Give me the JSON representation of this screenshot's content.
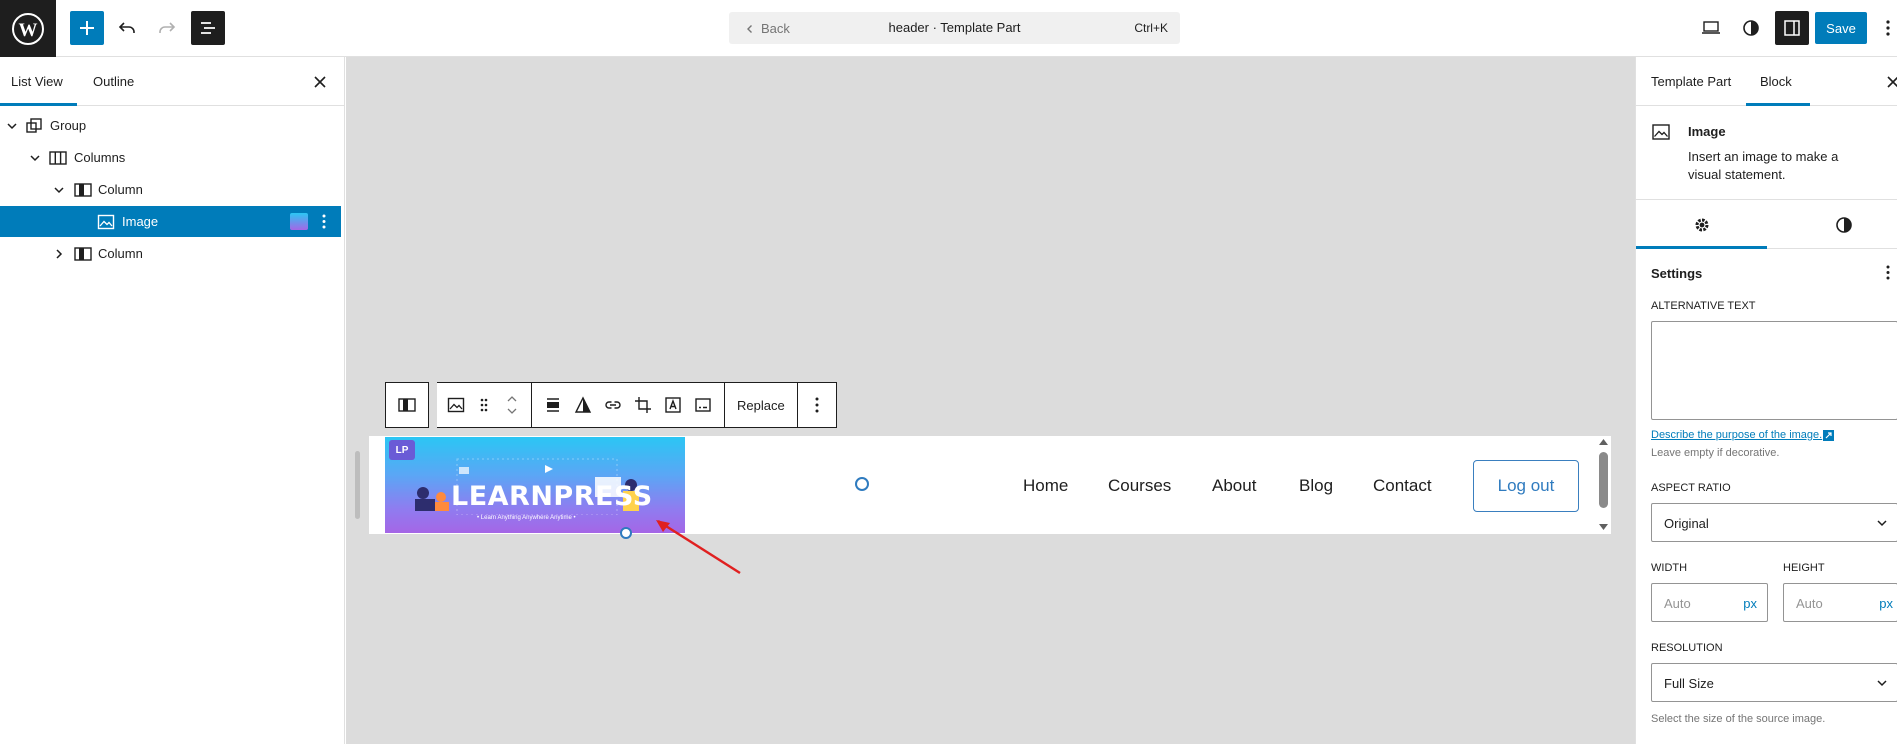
{
  "topbar": {
    "back_label": "Back",
    "doc_title": "header · Template Part",
    "shortcut": "Ctrl+K",
    "save_label": "Save"
  },
  "left_panel": {
    "tabs": [
      {
        "label": "List View",
        "active": true
      },
      {
        "label": "Outline",
        "active": false
      }
    ],
    "tree": [
      {
        "label": "Group",
        "level": 0,
        "expanded": true,
        "selected": false
      },
      {
        "label": "Columns",
        "level": 1,
        "expanded": true,
        "selected": false
      },
      {
        "label": "Column",
        "level": 2,
        "expanded": true,
        "selected": false
      },
      {
        "label": "Image",
        "level": 3,
        "expanded": false,
        "selected": true
      },
      {
        "label": "Column",
        "level": 2,
        "expanded": false,
        "selected": false
      }
    ]
  },
  "toolbar": {
    "replace_label": "Replace"
  },
  "canvas": {
    "banner_title": "LEARNPRESS",
    "banner_tagline": "• Learn Anything Anywhere Anytime •",
    "nav": [
      "Home",
      "Courses",
      "About",
      "Blog",
      "Contact"
    ],
    "logout_label": "Log out"
  },
  "right_panel": {
    "tabs": [
      {
        "label": "Template Part",
        "active": false
      },
      {
        "label": "Block",
        "active": true
      }
    ],
    "block_title": "Image",
    "block_desc": "Insert an image to make a visual statement.",
    "settings_title": "Settings",
    "alt_text_label": "ALTERNATIVE TEXT",
    "alt_text_value": "",
    "alt_link": "Describe the purpose of the image.",
    "alt_help": "Leave empty if decorative.",
    "aspect_label": "ASPECT RATIO",
    "aspect_value": "Original",
    "width_label": "WIDTH",
    "height_label": "HEIGHT",
    "width_placeholder": "Auto",
    "height_placeholder": "Auto",
    "unit": "px",
    "resolution_label": "RESOLUTION",
    "resolution_value": "Full Size",
    "resolution_help": "Select the size of the source image."
  },
  "colors": {
    "accent": "#007cba",
    "dark": "#1e1e1e",
    "canvas_bg": "#dcdcdc",
    "annotation_arrow": "#e02020"
  }
}
